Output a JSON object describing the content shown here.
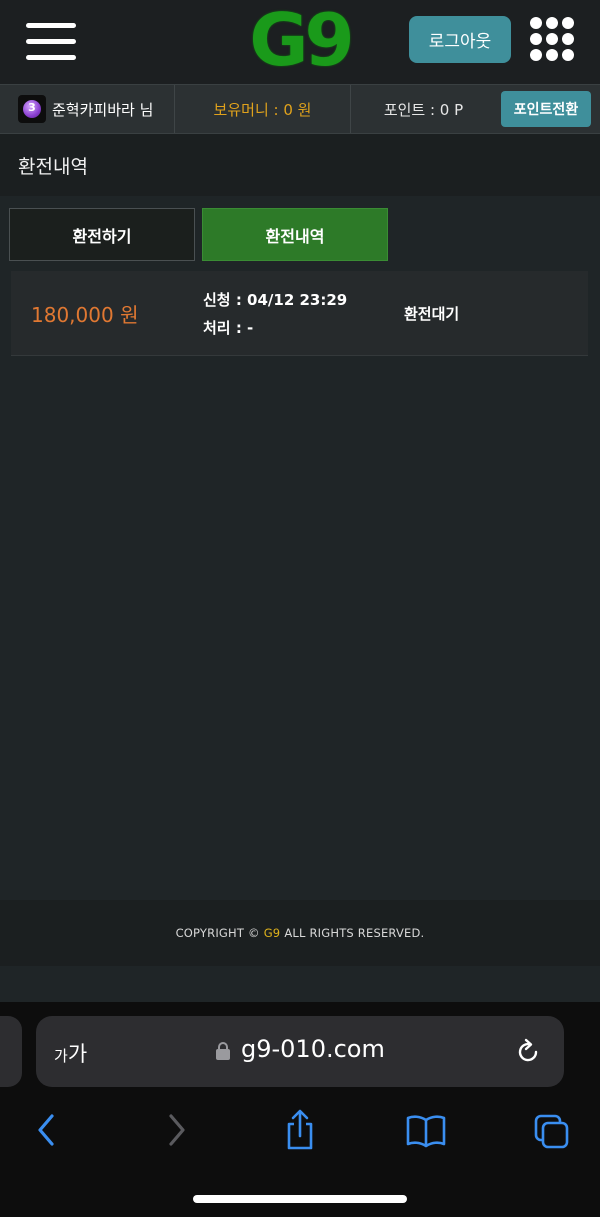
{
  "header": {
    "logo_text": "G9",
    "logout_label": "로그아웃"
  },
  "infobar": {
    "username": "준혁카피바라 님",
    "avatar_glyph": "3",
    "money_label": "보유머니 : 0 원",
    "point_label": "포인트 : 0 P",
    "convert_label": "포인트전환"
  },
  "section": {
    "title": "환전내역"
  },
  "tabs": [
    {
      "label": "환전하기",
      "active": false
    },
    {
      "label": "환전내역",
      "active": true
    }
  ],
  "records": [
    {
      "amount": "180,000 원",
      "requested": "신청 : 04/12 23:29",
      "processed": "처리 : -",
      "status": "환전대기"
    }
  ],
  "footer": {
    "prefix": "COPYRIGHT ©",
    "brand": "G9",
    "suffix": "ALL RIGHTS RESERVED."
  },
  "browser": {
    "text_size_label_small": "가",
    "text_size_label_large": "가",
    "url": "g9-010.com"
  },
  "colors": {
    "accent_teal": "#3f8f9b",
    "active_tab_green": "#2d7a28",
    "amount_orange": "#e07832",
    "money_gold": "#e0a21c",
    "ios_blue": "#3a8ef0"
  }
}
